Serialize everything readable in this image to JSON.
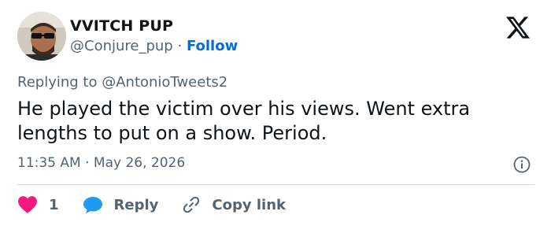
{
  "author": {
    "display_name": "VVITCH PUP",
    "handle": "@Conjure_pup",
    "separator": "·",
    "follow_label": "Follow",
    "avatar_icon": "user-avatar-photo"
  },
  "brand": {
    "logo_icon": "x-logo-icon",
    "color": "#0f1419"
  },
  "reply_context": {
    "prefix": "Replying to",
    "mention": "@AntonioTweets2"
  },
  "tweet": {
    "text": "He played the victim over his views. Went extra lengths to put on a show. Period.",
    "time": "11:35 AM",
    "separator": "·",
    "date": "May 26, 2026"
  },
  "info": {
    "icon": "info-icon"
  },
  "actions": {
    "like": {
      "icon": "heart-icon",
      "count": "1",
      "color": "#f91880"
    },
    "reply": {
      "icon": "speech-bubble-icon",
      "label": "Reply",
      "color": "#1d9bf0"
    },
    "copy_link": {
      "icon": "link-icon",
      "label": "Copy link"
    }
  },
  "colors": {
    "text_primary": "#0f1419",
    "text_secondary": "#536471",
    "link": "#006fd6",
    "divider": "#cfd9de"
  }
}
